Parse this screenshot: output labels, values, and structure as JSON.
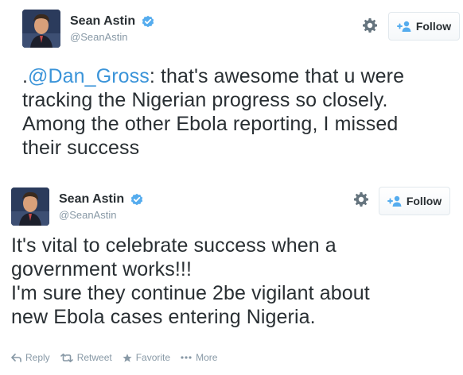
{
  "tweets": [
    {
      "author": {
        "fullname": "Sean Astin",
        "screenname": "@SeanAstin",
        "verified": true
      },
      "follow_label": "Follow",
      "text": {
        "prefix": ".",
        "mention": "@Dan_Gross",
        "line1_rest": ": that's awesome that u were",
        "line2": "tracking the Nigerian progress so closely.",
        "line3": "Among the other Ebola reporting, I missed",
        "line4": "their success"
      }
    },
    {
      "author": {
        "fullname": "Sean Astin",
        "screenname": "@SeanAstin",
        "verified": true
      },
      "follow_label": "Follow",
      "text": {
        "line1": "It's vital to celebrate success when a",
        "line2": "government works!!!",
        "line3": "I'm sure they continue 2be vigilant about",
        "line4": "new Ebola cases entering Nigeria."
      },
      "actions": {
        "reply": "Reply",
        "retweet": "Retweet",
        "favorite": "Favorite",
        "more": "More"
      }
    }
  ],
  "colors": {
    "text": "#292f33",
    "muted": "#8899a6",
    "link": "#3b94d9",
    "verified": "#55acee",
    "border": "#e1e8ed"
  },
  "icons": [
    "verified-badge-icon",
    "gear-icon",
    "add-user-icon",
    "reply-icon",
    "retweet-icon",
    "star-icon",
    "more-dots-icon"
  ]
}
